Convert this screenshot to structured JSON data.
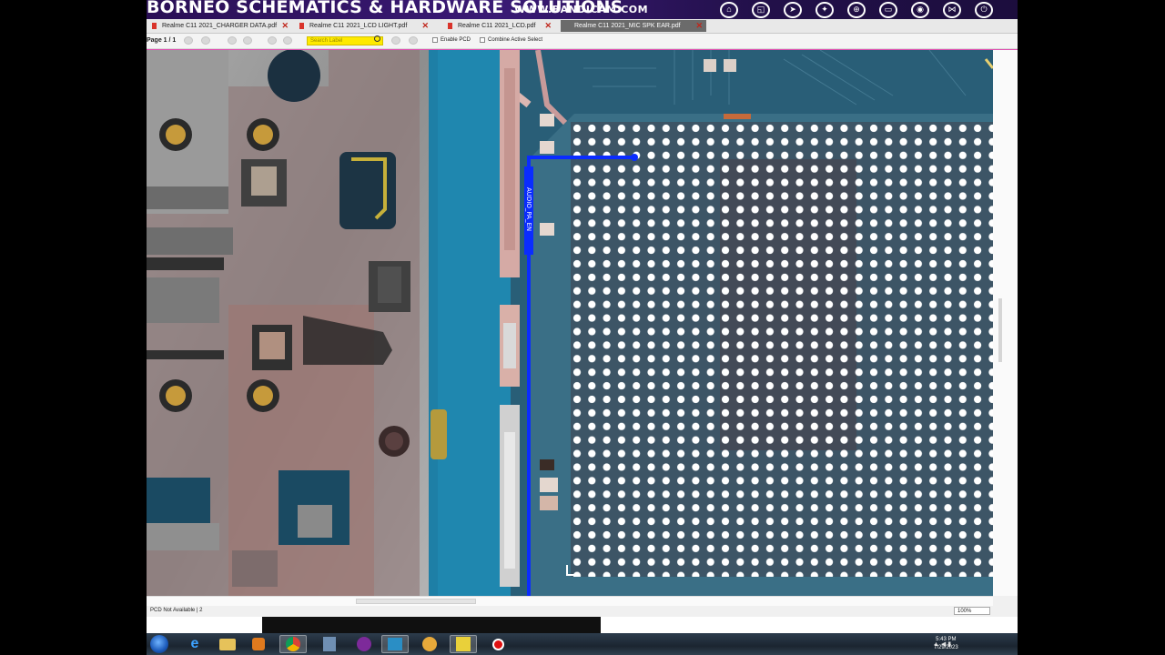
{
  "banner": {
    "title": "BORNEO SCHEMATICS & HARDWARE SOLUTIONS",
    "url": "WWW.BANDICAM.COM",
    "icons": [
      "home-icon",
      "crop-icon",
      "cursor-icon",
      "magic-wand-icon",
      "zoom-icon",
      "folder-icon",
      "camera-icon",
      "share-icon",
      "power-icon"
    ]
  },
  "tabs": [
    {
      "label": "Realme C11 2021_CHARGER DATA.pdf",
      "active": false
    },
    {
      "label": "Realme C11 2021_LCD LIGHT.pdf",
      "active": false
    },
    {
      "label": "Realme C11 2021_LCD.pdf",
      "active": false
    },
    {
      "label": "Realme C11 2021_MIC SPK EAR.pdf",
      "active": true
    }
  ],
  "toolbar": {
    "page_indicator": "Page 1 / 1",
    "search_placeholder": "Search Label",
    "enable_pcd_label": "Enable PCD",
    "combine_active_label": "Combine Active Select"
  },
  "board": {
    "net_label": "AUDIO_PA_EN",
    "trace_color": "#0a2cff",
    "board_color": "#1e7fa6",
    "ic_color": "#3d5566",
    "bga_pad_color": "#ffffff"
  },
  "status": {
    "text": "PCD Not Available | 2",
    "zoom": "100%"
  },
  "taskbar": {
    "time": "5:43 PM",
    "date": "7/29/2023",
    "apps": [
      "ie-icon",
      "explorer-icon",
      "media-player-icon",
      "chrome-icon",
      "app-icon",
      "app2-icon",
      "app3-icon",
      "app4-icon",
      "shield-icon",
      "record-icon"
    ]
  }
}
